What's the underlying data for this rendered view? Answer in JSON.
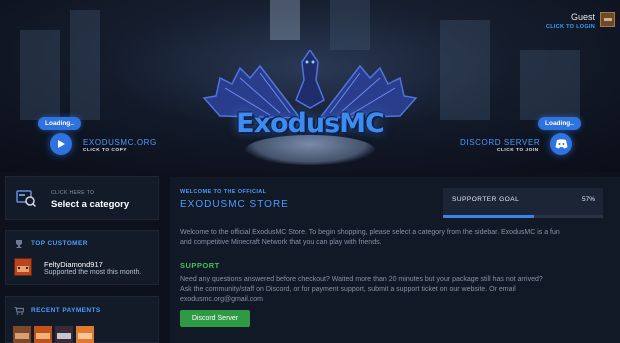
{
  "header": {
    "guest_name": "Guest",
    "guest_login": "CLICK TO LOGIN",
    "logo_text": "ExodusMC"
  },
  "server_link": {
    "loading": "Loading..",
    "title": "EXODUSMC.ORG",
    "subtitle": "CLICK TO COPY",
    "icon": "play-icon"
  },
  "discord_link": {
    "loading": "Loading..",
    "title": "DISCORD SERVER",
    "subtitle": "CLICK TO JOIN",
    "icon": "discord-icon"
  },
  "sidebar": {
    "category": {
      "small": "CLICK HERE TO",
      "label": "Select a category",
      "icon": "store-icon"
    },
    "top_customer": {
      "title": "TOP CUSTOMER",
      "icon": "trophy-icon",
      "name": "FeltyDiamond917",
      "description": "Supported the most this month."
    },
    "recent_payments": {
      "title": "RECENT PAYMENTS",
      "icon": "cart-icon",
      "avatars": [
        "player-avatar-1",
        "player-avatar-2",
        "player-avatar-3",
        "player-avatar-4"
      ]
    }
  },
  "main": {
    "welcome_small": "WELCOME TO THE OFFICIAL",
    "welcome_title": "EXODUSMC STORE",
    "intro_line1": "Welcome to the official ExodusMC Store. To begin shopping, please select a category from the sidebar. ExodusMC is a fun",
    "intro_line2": "and competitive Minecraft Network that you can play with friends.",
    "support_title": "SUPPORT",
    "support_line1": "Need any questions answered before checkout? Waited more than 20 minutes but your package still has not arrived?",
    "support_line2": "Ask the community/staff on Discord, or for payment support, submit a support ticket on our website. Or email",
    "support_line3": "exodusmc.org@gmail.com",
    "discord_button": "Discord Server"
  },
  "goal": {
    "label": "SUPPORTER GOAL",
    "percent_text": "57%",
    "fraction": 0.57
  },
  "colors": {
    "accent": "#3b82f0",
    "support_green": "#3fc35a",
    "button_green": "#2f9a45",
    "background": "#0c111c"
  }
}
